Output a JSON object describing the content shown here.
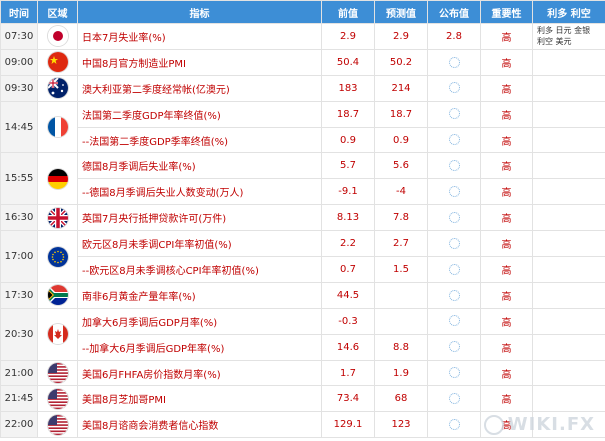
{
  "headers": {
    "time": "时间",
    "region": "区域",
    "indicator": "指标",
    "previous": "前值",
    "forecast": "预测值",
    "published": "公布值",
    "importance": "重要性",
    "note": "利多 利空"
  },
  "note": {
    "bull_label": "利多",
    "bull_value": "日元 金银",
    "bear_label": "利空",
    "bear_value": "美元"
  },
  "rows": [
    {
      "time": "07:30",
      "flag": "jp",
      "indicator": "日本7月失业率(%)",
      "previous": "2.9",
      "forecast": "2.9",
      "published": "2.8",
      "importance": "高"
    },
    {
      "time": "09:00",
      "flag": "cn",
      "indicator": "中国8月官方制造业PMI",
      "previous": "50.4",
      "forecast": "50.2",
      "published": "",
      "importance": "高"
    },
    {
      "time": "09:30",
      "flag": "au",
      "indicator": "澳大利亚第二季度经常帐(亿澳元)",
      "previous": "183",
      "forecast": "214",
      "published": "",
      "importance": "高"
    },
    {
      "time": "14:45",
      "flag": "fr",
      "indicator": "法国第二季度GDP年率终值(%)",
      "previous": "18.7",
      "forecast": "18.7",
      "published": "",
      "importance": "高"
    },
    {
      "time": "",
      "flag": "",
      "indicator": "--法国第二季度GDP季率终值(%)",
      "previous": "0.9",
      "forecast": "0.9",
      "published": "",
      "importance": "高"
    },
    {
      "time": "15:55",
      "flag": "de",
      "indicator": "德国8月季调后失业率(%)",
      "previous": "5.7",
      "forecast": "5.6",
      "published": "",
      "importance": "高"
    },
    {
      "time": "",
      "flag": "",
      "indicator": "--德国8月季调后失业人数变动(万人)",
      "previous": "-9.1",
      "forecast": "-4",
      "published": "",
      "importance": "高"
    },
    {
      "time": "16:30",
      "flag": "gb",
      "indicator": "英国7月央行抵押贷款许可(万件)",
      "previous": "8.13",
      "forecast": "7.8",
      "published": "",
      "importance": "高"
    },
    {
      "time": "17:00",
      "flag": "eu",
      "indicator": "欧元区8月未季调CPI年率初值(%)",
      "previous": "2.2",
      "forecast": "2.7",
      "published": "",
      "importance": "高"
    },
    {
      "time": "",
      "flag": "",
      "indicator": "--欧元区8月未季调核心CPI年率初值(%)",
      "previous": "0.7",
      "forecast": "1.5",
      "published": "",
      "importance": "高"
    },
    {
      "time": "17:30",
      "flag": "za",
      "indicator": "南非6月黄金产量年率(%)",
      "previous": "44.5",
      "forecast": "",
      "published": "",
      "importance": "高"
    },
    {
      "time": "20:30",
      "flag": "ca",
      "indicator": "加拿大6月季调后GDP月率(%)",
      "previous": "-0.3",
      "forecast": "",
      "published": "",
      "importance": "高"
    },
    {
      "time": "",
      "flag": "",
      "indicator": "--加拿大6月季调后GDP年率(%)",
      "previous": "14.6",
      "forecast": "8.8",
      "published": "",
      "importance": "高"
    },
    {
      "time": "21:00",
      "flag": "us",
      "indicator": "美国6月FHFA房价指数月率(%)",
      "previous": "1.7",
      "forecast": "1.9",
      "published": "",
      "importance": "高"
    },
    {
      "time": "21:45",
      "flag": "us",
      "indicator": "美国8月芝加哥PMI",
      "previous": "73.4",
      "forecast": "68",
      "published": "",
      "importance": "高"
    },
    {
      "time": "22:00",
      "flag": "us",
      "indicator": "美国8月谘商会消费者信心指数",
      "previous": "129.1",
      "forecast": "123",
      "published": "",
      "importance": "高"
    }
  ],
  "watermark": "WIKI.FX"
}
